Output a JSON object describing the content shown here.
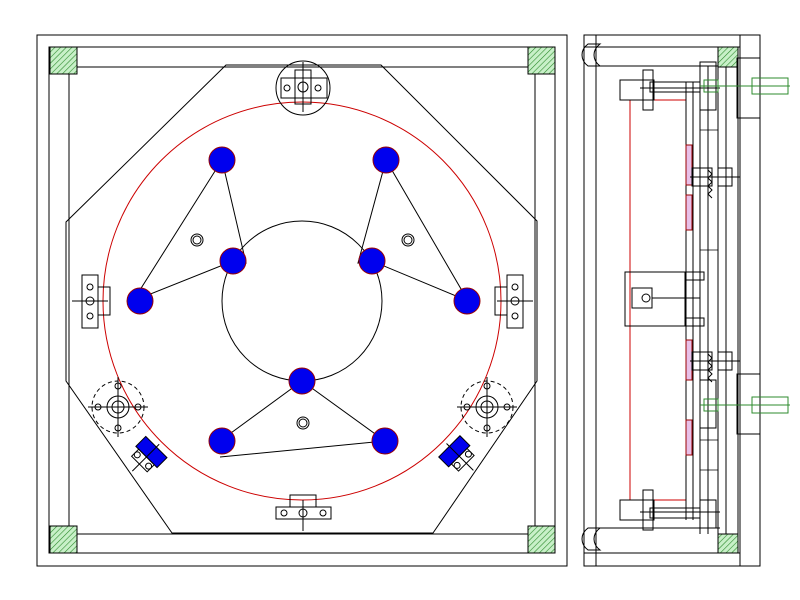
{
  "colors": {
    "background": "#ffffff",
    "line": "#000000",
    "circle": "#cc0000",
    "pad_fill": "#0000ee",
    "pad_stroke": "#990000",
    "hatch": "#2e8b2e",
    "hatch_fill": "#c8f0c8"
  },
  "views": {
    "front": {
      "pads": 9,
      "pad_groups": 3,
      "locator_holes": 3,
      "side_clamps": 4,
      "corner_posts": 4
    },
    "side": {
      "clamp_assemblies": 4,
      "support_brackets": 1
    }
  },
  "icons": {
    "pad": "filled-circle",
    "clamp": "clamp-block",
    "post": "hatched-square"
  }
}
